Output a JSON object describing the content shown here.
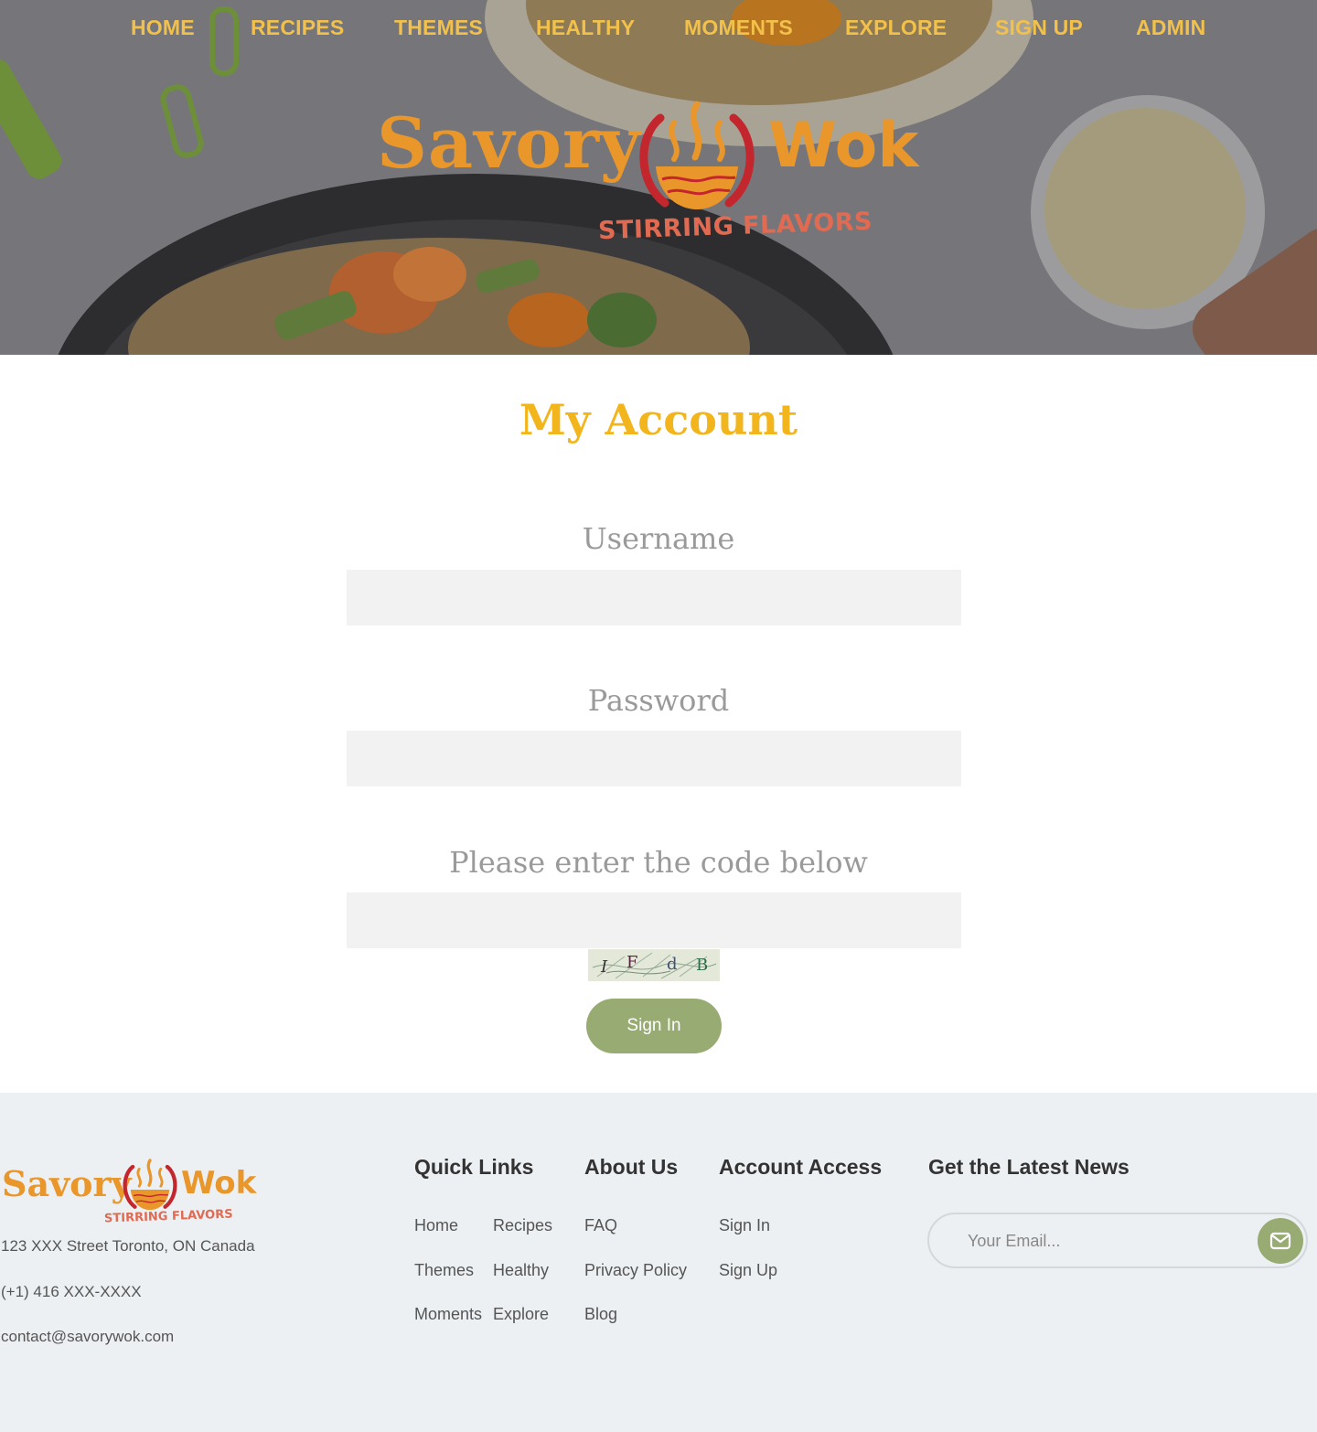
{
  "nav": {
    "items": [
      {
        "label": "HOME"
      },
      {
        "label": "RECIPES"
      },
      {
        "label": "THEMES"
      },
      {
        "label": "HEALTHY"
      },
      {
        "label": "MOMENTS"
      },
      {
        "label": "EXPLORE"
      },
      {
        "label": "SIGN UP"
      },
      {
        "label": "ADMIN"
      }
    ]
  },
  "brand": {
    "name_left": "Savory",
    "name_right": "Wok",
    "tagline": "STIRRING FLAVORS"
  },
  "main": {
    "title": "My Account",
    "username_label": "Username",
    "username_value": "",
    "password_label": "Password",
    "password_value": "",
    "code_label": "Please enter the code below",
    "code_value": "",
    "captcha_text": "I F d B",
    "signin_label": "Sign In"
  },
  "footer": {
    "address": "123 XXX Street Toronto, ON Canada",
    "phone": "(+1) 416 XXX-XXXX",
    "email": "contact@savorywok.com",
    "quick_links": {
      "heading": "Quick Links",
      "links": [
        "Home",
        "Recipes",
        "Themes",
        "Healthy",
        "Moments",
        "Explore"
      ]
    },
    "about": {
      "heading": "About Us",
      "links": [
        "FAQ",
        "Privacy Policy",
        "Blog"
      ]
    },
    "account": {
      "heading": "Account Access",
      "links": [
        "Sign In",
        "Sign Up"
      ]
    },
    "news": {
      "heading": "Get the Latest News",
      "email_placeholder": "Your Email...",
      "email_value": ""
    }
  },
  "colors": {
    "nav_text": "#f2c14b",
    "brand_orange": "#e9962a",
    "brand_red": "#c4262e",
    "tagline_red": "#e06a52",
    "title_yellow": "#f3b51c",
    "button_green": "#97ab72",
    "footer_bg": "#ecf0f3"
  },
  "icons": {
    "logo": "steaming-bowl-icon",
    "send": "envelope-icon"
  }
}
